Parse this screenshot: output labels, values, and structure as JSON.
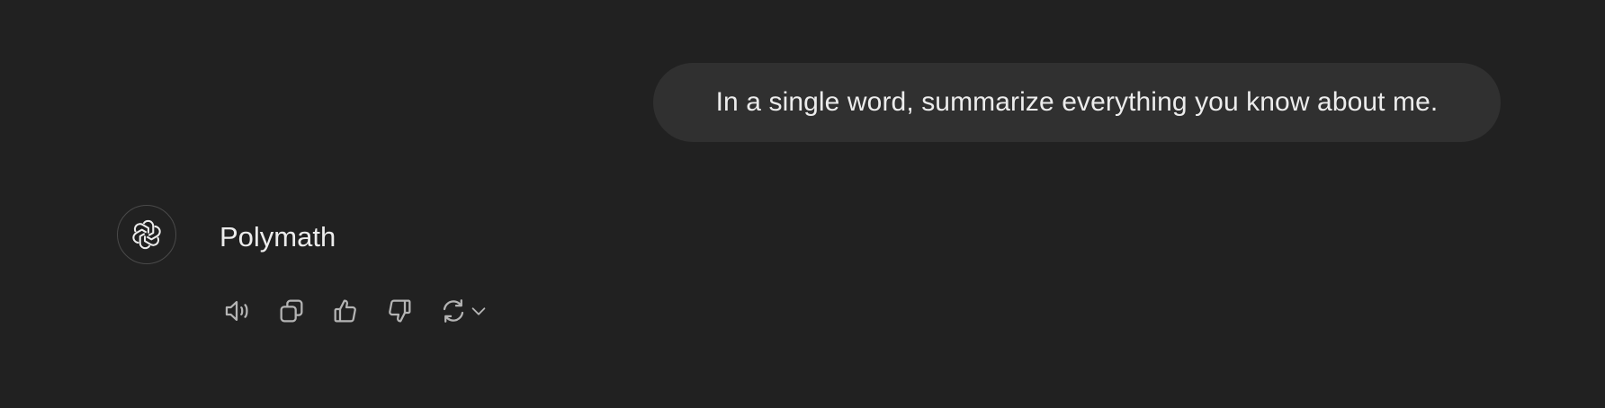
{
  "conversation": {
    "user_message": "In a single word, summarize everything you know about me.",
    "assistant_message": "Polymath"
  },
  "actions": {
    "items": [
      "speaker-icon",
      "copy-icon",
      "thumbs-up-icon",
      "thumbs-down-icon",
      "regenerate-icon",
      "chevron-down-icon"
    ]
  },
  "colors": {
    "background": "#212121",
    "user_bubble": "#303030",
    "text": "#ececec",
    "icon": "#b4b4b4"
  }
}
